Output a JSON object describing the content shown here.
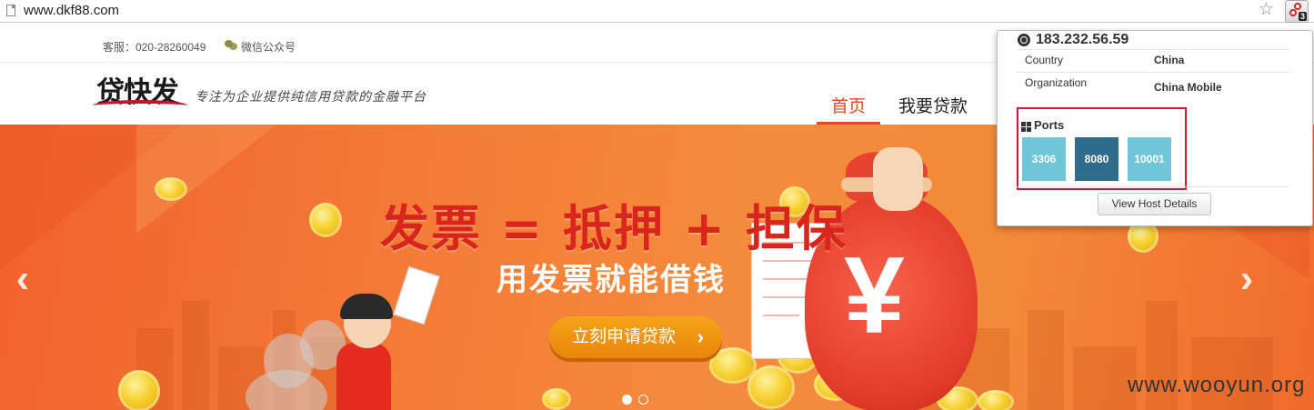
{
  "browser": {
    "url": "www.dkf88.com",
    "bookmark_icon": "star-icon",
    "extension_icon": "shodan-extension-icon",
    "extension_badge": "3"
  },
  "topbar": {
    "service": "客服：020-28260049",
    "wechat": "微信公众号"
  },
  "header": {
    "logo": "贷快发",
    "slogan": "专注为企业提供纯信用贷款的金融平台",
    "nav": [
      "首页",
      "我要贷款"
    ],
    "active_color": "#e34b1a"
  },
  "banner": {
    "headline": "发票 = 抵押 + 担保",
    "subline": "用发票就能借钱",
    "cta": "立刻申请贷款",
    "cta_arrow": "›",
    "prev": "‹",
    "next": "›",
    "watermark": "www.wooyun.org",
    "slide_count": 2,
    "active_slide": 1
  },
  "popup": {
    "ip": "183.232.56.59",
    "rows": [
      {
        "label": "Country",
        "value": "China"
      },
      {
        "label": "Organization",
        "value": "China Mobile"
      }
    ],
    "ports_title": "Ports",
    "ports": [
      {
        "label": "3306",
        "color": "#6ec6d8"
      },
      {
        "label": "8080",
        "color": "#2f6b8a"
      },
      {
        "label": "10001",
        "color": "#6ec6d8"
      }
    ],
    "view_button": "View Host Details"
  }
}
